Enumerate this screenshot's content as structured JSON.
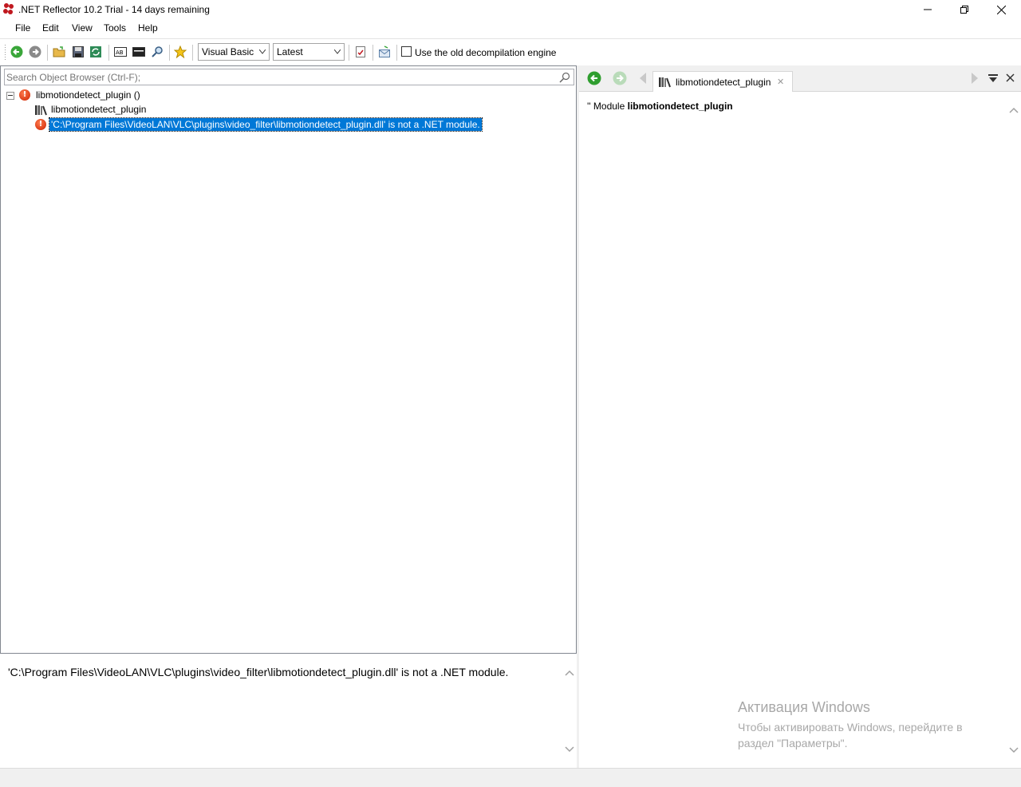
{
  "window": {
    "title": ".NET Reflector 10.2 Trial - 14 days remaining",
    "controls": [
      "minimize-icon",
      "maximize-icon",
      "close-icon"
    ]
  },
  "menu": {
    "items": [
      "File",
      "Edit",
      "View",
      "Tools",
      "Help"
    ]
  },
  "toolbar": {
    "icons": [
      "back-icon",
      "forward-icon",
      "open-icon",
      "save-icon",
      "refresh-icon",
      "ab-icon",
      "console-icon",
      "search-icon",
      "favorite-icon",
      "analyze-icon",
      "export-icon"
    ],
    "language": "Visual Basic",
    "version": "Latest",
    "old_engine_label": "Use the old decompilation engine",
    "old_engine_checked": false
  },
  "object_browser": {
    "search_placeholder": "Search Object Browser (Ctrl-F);",
    "tree": {
      "root": "libmotiondetect_plugin ()",
      "module": "libmotiondetect_plugin",
      "error": "'C:\\Program Files\\VideoLAN\\VLC\\plugins\\video_filter\\libmotiondetect_plugin.dll' is not a .NET module."
    }
  },
  "description": {
    "text": "'C:\\Program Files\\VideoLAN\\VLC\\plugins\\video_filter\\libmotiondetect_plugin.dll' is not a .NET module."
  },
  "decompiler": {
    "tab_label": "libmotiondetect_plugin",
    "code_prefix": "'' Module ",
    "code_name": "libmotiondetect_plugin"
  },
  "watermark": {
    "title": "Активация Windows",
    "line1": "Чтобы активировать Windows, перейдите в",
    "line2": "раздел \"Параметры\"."
  },
  "colors": {
    "selection": "#0078d7",
    "error": "#cc2200",
    "nav_green": "#2f9e2f"
  }
}
